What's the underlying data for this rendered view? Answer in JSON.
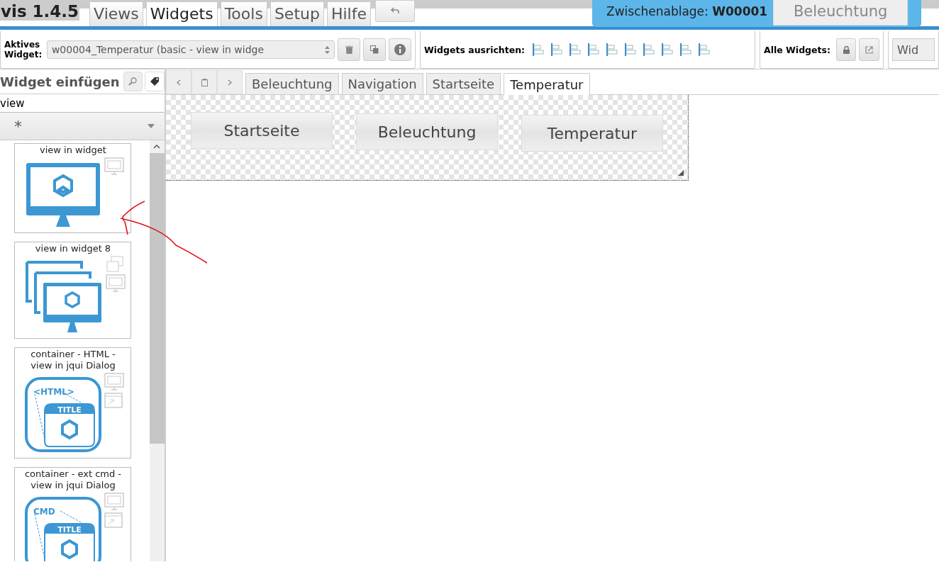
{
  "app": {
    "title": "vis 1.4.5"
  },
  "menu_tabs": [
    {
      "label": "Views",
      "selected": false
    },
    {
      "label": "Widgets",
      "selected": true
    },
    {
      "label": "Tools",
      "selected": false
    },
    {
      "label": "Setup",
      "selected": false
    },
    {
      "label": "Hilfe",
      "selected": false
    }
  ],
  "clipboard": {
    "label": "Zwischenablage: ",
    "widget_id": "W00001",
    "view_button": "Beleuchtung"
  },
  "toolbar": {
    "active_widget_label": "Aktives Widget:",
    "active_widget_value": "w00004_Temperatur (basic - view in widge",
    "align_label": "Widgets ausrichten:",
    "all_widgets_label": "Alle Widgets:",
    "cut_button": "Wid"
  },
  "insert_panel": {
    "title": "Widget einfügen",
    "filter": "view",
    "set_select": "*",
    "widgets": [
      {
        "title": "view in widget",
        "kind": "monitor"
      },
      {
        "title": "view in widget 8",
        "kind": "monitor-stack"
      },
      {
        "title": "container - HTML - view in jqui Dialog",
        "kind": "dialog",
        "badge": "<HTML>",
        "bar": "TITLE"
      },
      {
        "title": "container - ext cmd - view in jqui Dialog",
        "kind": "dialog",
        "badge": "CMD",
        "bar": "TITLE"
      }
    ]
  },
  "view_tabs": [
    {
      "label": "Beleuchtung",
      "selected": false
    },
    {
      "label": "Navigation",
      "selected": false
    },
    {
      "label": "Startseite",
      "selected": false
    },
    {
      "label": "Temperatur",
      "selected": true
    }
  ],
  "canvas_buttons": [
    "Startseite",
    "Beleuchtung",
    "Temperatur"
  ]
}
